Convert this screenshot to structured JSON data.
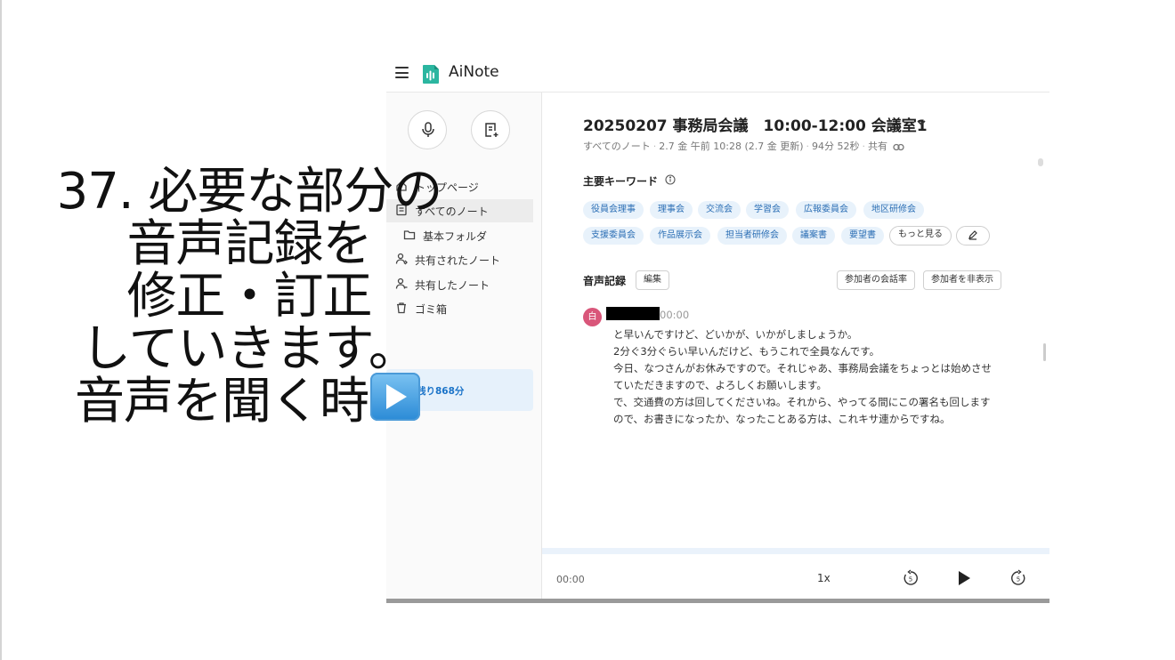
{
  "app": {
    "brand": "AiNote"
  },
  "sidebar": {
    "items": [
      {
        "label": "トップページ"
      },
      {
        "label": "すべてのノート"
      },
      {
        "label": "基本フォルダ"
      },
      {
        "label": "共有されたノート"
      },
      {
        "label": "共有したノート"
      },
      {
        "label": "ゴミ箱"
      }
    ],
    "remaining": "残り868分"
  },
  "note": {
    "title": "20250207 事務局会議　10:00-12:00 会議室1",
    "breadcrumb": "すべてのノート",
    "date": "2.7 金 午前 10:28 (2.7 金 更新)",
    "duration": "94分 52秒",
    "share": "共有"
  },
  "keywords": {
    "heading": "主要キーワード",
    "items": [
      "役員会理事",
      "理事会",
      "交流会",
      "学習会",
      "広報委員会",
      "地区研修会",
      "支援委員会",
      "作品展示会",
      "担当者研修会",
      "議案書",
      "要望書"
    ],
    "more_label": "もっと見る"
  },
  "transcript": {
    "heading": "音声記録",
    "edit_label": "編集",
    "rate_label": "参加者の会話率",
    "hide_label": "参加者を非表示",
    "speaker_initial": "白",
    "time": "00:00",
    "lines": [
      "と早いんですけど、どいかが、いかがしましょうか。",
      "2分ぐ3分ぐらい早いんだけど、もうこれで全員なんです。",
      "今日、なつさんがお休みですので。それじゃあ、事務局会議をちょっとは始めさせ",
      "ていただきますので、よろしくお願いします。",
      "で、交通費の方は回してくださいね。それから、やってる間にこの署名も回します",
      "ので、お書きになったか、なったことある方は、これキサ連からですね。"
    ]
  },
  "player": {
    "time": "00:00",
    "speed": "1x"
  },
  "caption": {
    "lines": [
      "37. 必要な部分の",
      "音声記録を",
      "修正・訂正",
      "していきます。",
      "音声を聞く時は"
    ]
  },
  "colors": {
    "accent": "#2c6fb5",
    "chip_bg": "#e8f2fb",
    "avatar": "#d9567a"
  }
}
